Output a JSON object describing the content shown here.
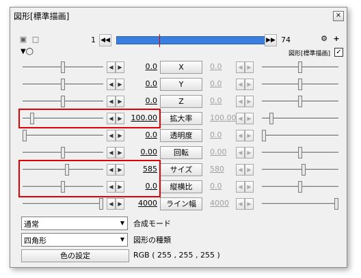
{
  "window": {
    "title": "図形[標準描画]",
    "close_icon": "×"
  },
  "toolbar": {
    "frame_start": "1",
    "frame_end": "74",
    "timeline_fill": 1.0,
    "cursor_position": 0.28
  },
  "header": {
    "label": "図形[標準描画]",
    "checked": "✓"
  },
  "params": [
    {
      "label": "X",
      "left_value": "0.0",
      "right_value": "0.0",
      "left_slider": 0.5,
      "right_slider": 0.5
    },
    {
      "label": "Y",
      "left_value": "0.0",
      "right_value": "0.0",
      "left_slider": 0.5,
      "right_slider": 0.5
    },
    {
      "label": "Z",
      "left_value": "0.0",
      "right_value": "0.0",
      "left_slider": 0.5,
      "right_slider": 0.5
    },
    {
      "label": "拡大率",
      "left_value": "100.00",
      "right_value": "100.00",
      "left_slider": 0.1,
      "right_slider": 0.1
    },
    {
      "label": "透明度",
      "left_value": "0.0",
      "right_value": "0.0",
      "left_slider": 0.0,
      "right_slider": 0.0
    },
    {
      "label": "回転",
      "left_value": "0.00",
      "right_value": "0.00",
      "left_slider": 0.5,
      "right_slider": 0.5
    },
    {
      "label": "サイズ",
      "left_value": "585",
      "right_value": "580",
      "left_slider": 0.55,
      "right_slider": 0.55
    },
    {
      "label": "縦横比",
      "left_value": "0.0",
      "right_value": "0.0",
      "left_slider": 0.5,
      "right_slider": 0.5
    },
    {
      "label": "ライン幅",
      "left_value": "4000",
      "right_value": "4000",
      "left_slider": 1.0,
      "right_slider": 1.0
    }
  ],
  "blend": {
    "value": "通常",
    "label": "合成モード"
  },
  "shape": {
    "value": "四角形",
    "label": "図形の種類"
  },
  "color": {
    "button_label": "色の設定",
    "rgb_text": "RGB ( 255 , 255 , 255 )"
  },
  "icons": {
    "play_first": "◀◀",
    "play_last": "▶▶",
    "arrow_left": "◀",
    "arrow_right": "▶",
    "dropdown": "▼",
    "plus": "+",
    "settings": "⚙"
  }
}
